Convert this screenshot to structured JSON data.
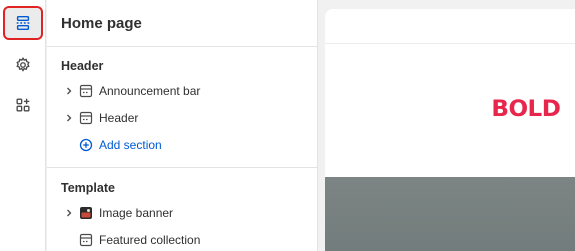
{
  "rail": {
    "items": [
      {
        "icon": "sections-icon",
        "active": true
      },
      {
        "icon": "gear-icon",
        "active": false
      },
      {
        "icon": "apps-icon",
        "active": false
      }
    ]
  },
  "panel": {
    "title": "Home page",
    "groups": {
      "header": {
        "title": "Header",
        "items": [
          {
            "label": "Announcement bar",
            "icon": "section-icon",
            "expandable": true
          },
          {
            "label": "Header",
            "icon": "section-icon",
            "expandable": true
          }
        ],
        "add_label": "Add section"
      },
      "template": {
        "title": "Template",
        "items": [
          {
            "label": "Image banner",
            "icon": "image-thumbnail-icon",
            "expandable": true
          },
          {
            "label": "Featured collection",
            "icon": "section-icon",
            "expandable": false
          }
        ]
      }
    }
  },
  "preview": {
    "logo_text": "BOLD",
    "accent_color": "#e8264c",
    "link_color": "#005bd3"
  }
}
